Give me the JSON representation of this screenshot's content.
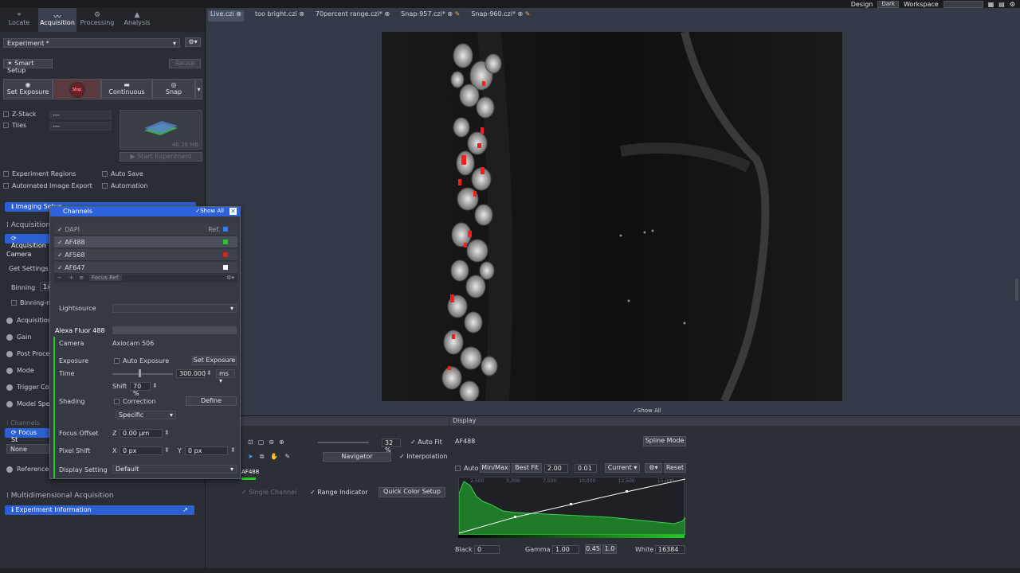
{
  "top": {
    "design_label": "Design",
    "design_value": "Dark",
    "workspace_label": "Workspace"
  },
  "tabs": [
    {
      "label": "Locate",
      "icon": "locate-icon"
    },
    {
      "label": "Acquisition",
      "icon": "acquisition-icon"
    },
    {
      "label": "Processing",
      "icon": "processing-icon"
    },
    {
      "label": "Analysis",
      "icon": "analysis-icon"
    }
  ],
  "left": {
    "experiment": "Experiment *",
    "smart_setup": "Smart Setup",
    "reuse": "Reuse",
    "set_exposure": "Set Exposure",
    "stop": "Stop",
    "continuous": "Continuous",
    "snap": "Snap",
    "zstack": "Z-Stack",
    "tiles": "Tiles",
    "dashes": "---",
    "size": "46.36 MB",
    "start_experiment": "Start Experiment",
    "experiment_regions": "Experiment Regions",
    "auto_save": "Auto Save",
    "automated_export": "Automated Image Export",
    "automation": "Automation",
    "imaging_setup": "Imaging Setup",
    "acquisition_header": "Acquisition",
    "acquisition_mode": "Acquisition",
    "camera": "Camera",
    "get_settings": "Get Settings fr",
    "binning": "Binning",
    "binning_val": "1x",
    "binning_mode": "Binning-m",
    "acq": "Acquisition",
    "gain": "Gain",
    "post_proc": "Post Proces",
    "mode": "Mode",
    "trigger": "Trigger Cor",
    "model_spec": "Model Spec",
    "channels_header": "Channels",
    "focus_strategy": "Focus St",
    "none": "None",
    "reference": "Reference C",
    "multidim": "Multidimensional Acquisition",
    "exp_info": "Experiment Information"
  },
  "popup": {
    "title": "Channels",
    "show_all": "Show All",
    "ref": "Ref.",
    "channels": [
      {
        "name": "DAPI",
        "color": "#2a7fff"
      },
      {
        "name": "AF488",
        "color": "#22cc22"
      },
      {
        "name": "AF568",
        "color": "#e02020"
      },
      {
        "name": "AF647",
        "color": "#ffffff"
      }
    ],
    "focus_ref": "Focus Ref.",
    "lightsource": "Lightsource",
    "dye": "Alexa Fluor 488",
    "camera_label": "Camera",
    "camera_value": "Axiocam 506",
    "exposure": "Exposure",
    "auto_exposure": "Auto Exposure",
    "set_exposure": "Set Exposure",
    "time": "Time",
    "time_value": "300.000",
    "time_unit": "ms",
    "shift": "Shift",
    "shift_value": "70 %",
    "shading": "Shading",
    "correction": "Correction",
    "define": "Define",
    "specific": "Specific",
    "focus_offset": "Focus Offset",
    "z": "Z",
    "z_value": "0.00 µm",
    "pixel_shift": "Pixel Shift",
    "x": "X",
    "x_value": "0 px",
    "y": "Y",
    "y_value": "0 px",
    "display_setting": "Display Setting",
    "display_value": "Default"
  },
  "image_tabs": [
    "Live.czi",
    "too bright.czi",
    "70percent range.czi*",
    "Snap-957.czi*",
    "Snap-960.czi*"
  ],
  "viewer": {
    "show_all": "Show All"
  },
  "bottom": {
    "zoom": "32 %",
    "auto_fit": "Auto Fit",
    "navigator": "Navigator",
    "interpolation": "Interpolation",
    "channel_tag": "AF488",
    "single_channel": "Single Channel",
    "range_indicator": "Range Indicator",
    "quick_color": "Quick Color Setup",
    "display_tab": "Display",
    "channel": "AF488",
    "spline_mode": "Spline Mode",
    "auto": "Auto",
    "minmax": "Min/Max",
    "bestfit": "Best Fit",
    "bf1": "2.00",
    "bf2": "0.01",
    "current": "Current",
    "reset": "Reset",
    "hist_ticks": [
      "2,500",
      "5,000",
      "7,500",
      "10,000",
      "12,500",
      "15,000"
    ],
    "black_label": "Black",
    "black": "0",
    "gamma_label": "Gamma",
    "gamma": "1.00",
    "g2": "0.45",
    "g3": "1.0",
    "white_label": "White",
    "white": "16384"
  }
}
